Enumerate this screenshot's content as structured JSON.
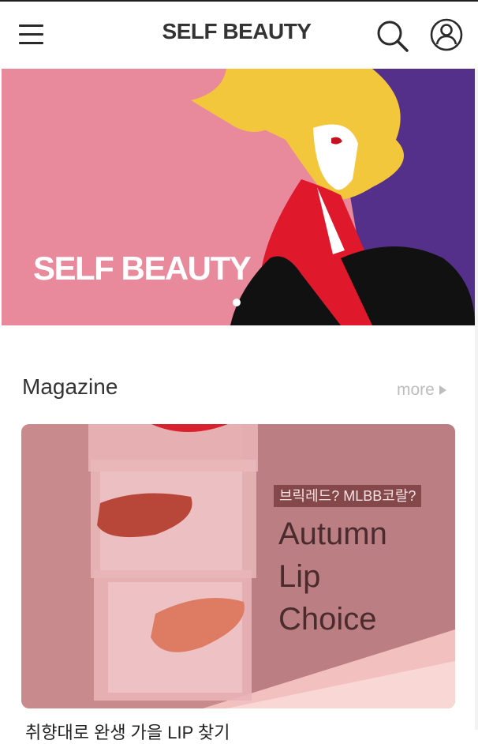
{
  "header": {
    "logo_text": "SELF BEAUTY",
    "menu_icon": "hamburger-menu-icon",
    "search_icon": "search-icon",
    "account_icon": "user-account-icon"
  },
  "hero": {
    "title": "SELF BEAUTY",
    "slide_count": 1,
    "active_slide": 1,
    "colors": {
      "pink": "#e8899c",
      "purple": "#54308a",
      "yellow": "#f3c73b",
      "red": "#e0182c"
    }
  },
  "magazine": {
    "title": "Magazine",
    "more_label": "more",
    "more_icon": "play-arrow-icon",
    "card": {
      "tag": "브릭레드? MLBB코랄?",
      "headline_lines": [
        "Autumn",
        "Lip",
        "Choice"
      ],
      "caption": "취향대로 완생 가을 LIP 찾기"
    }
  }
}
